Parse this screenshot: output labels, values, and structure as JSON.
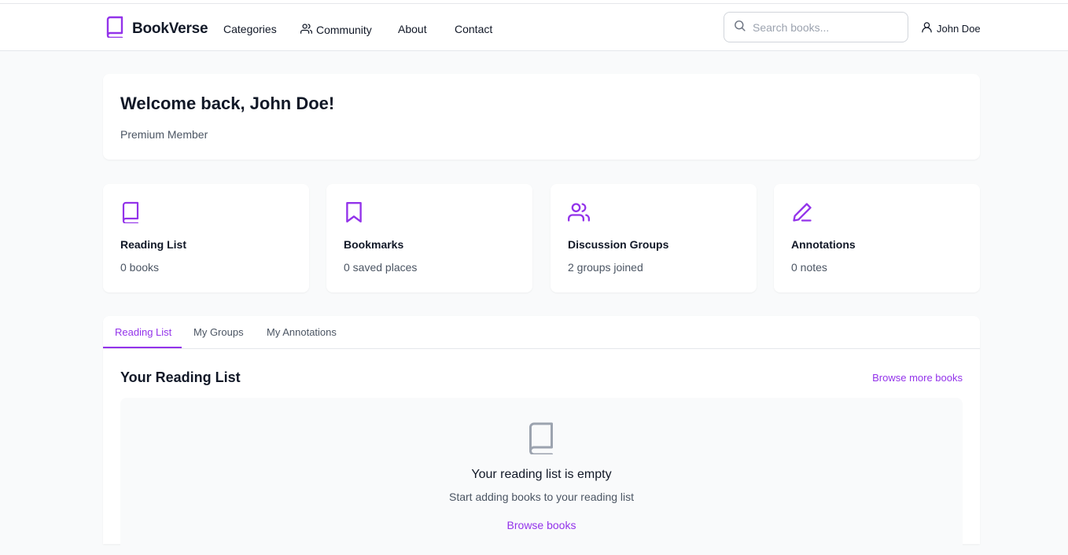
{
  "colors": {
    "accent": "#9333ea",
    "text": "#111827",
    "muted": "#4b5563",
    "background": "#f9fafb"
  },
  "nav": {
    "brand": "BookVerse",
    "brand_icon": "book-icon",
    "links": [
      {
        "label": "Categories"
      },
      {
        "label": "Community",
        "icon": "users-icon"
      },
      {
        "label": "About"
      },
      {
        "label": "Contact"
      }
    ],
    "search": {
      "placeholder": "Search books...",
      "value": ""
    },
    "user": {
      "name": "John Doe",
      "icon": "user-icon"
    }
  },
  "welcome": {
    "title": "Welcome back, John Doe!",
    "subtitle": "Premium Member"
  },
  "stats": [
    {
      "title": "Reading List",
      "value": "0 books",
      "icon": "book-icon"
    },
    {
      "title": "Bookmarks",
      "value": "0 saved places",
      "icon": "bookmark-icon"
    },
    {
      "title": "Discussion Groups",
      "value": "2 groups joined",
      "icon": "users-icon"
    },
    {
      "title": "Annotations",
      "value": "0 notes",
      "icon": "pen-icon"
    }
  ],
  "tabs": [
    {
      "label": "Reading List",
      "active": true
    },
    {
      "label": "My Groups",
      "active": false
    },
    {
      "label": "My Annotations",
      "active": false
    }
  ],
  "reading_list": {
    "title": "Your Reading List",
    "browse_more": "Browse more books",
    "empty": {
      "icon": "book-icon",
      "title": "Your reading list is empty",
      "subtitle": "Start adding books to your reading list",
      "action": "Browse books"
    }
  }
}
